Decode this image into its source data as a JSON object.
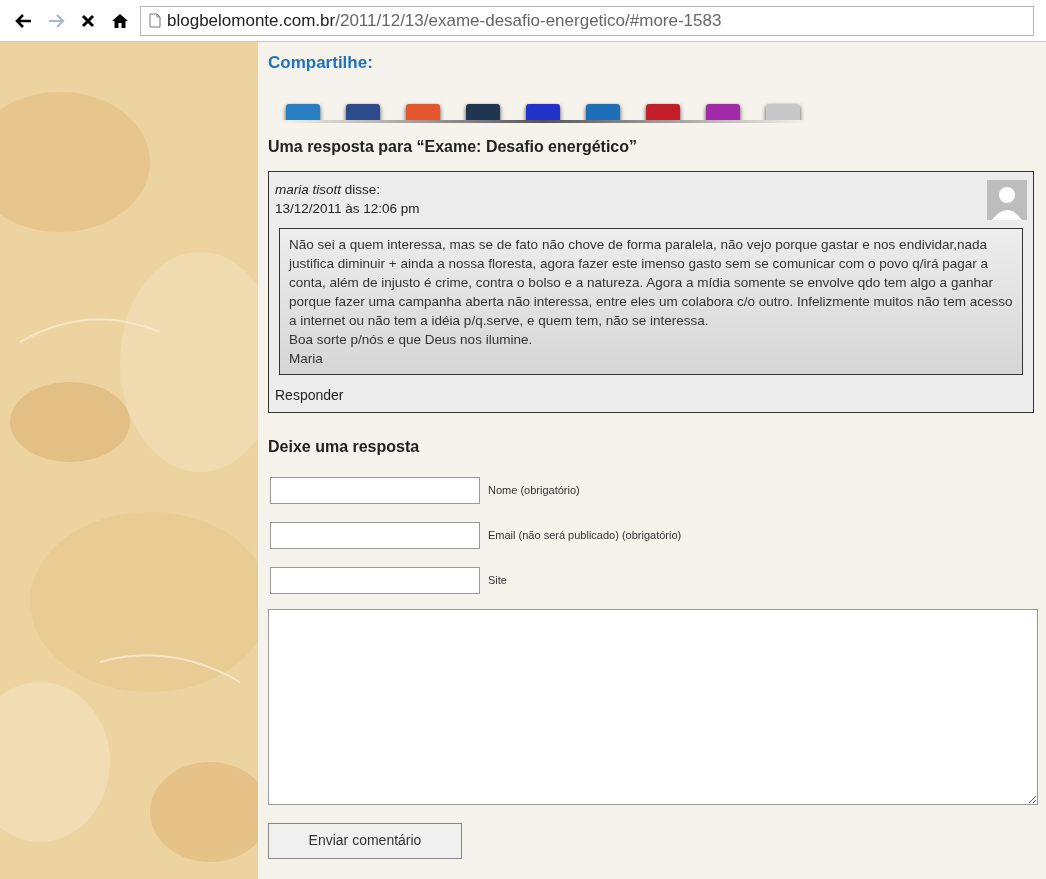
{
  "browser": {
    "back_disabled": false,
    "forward_disabled": true,
    "url_host": "blogbelomonte.com.br",
    "url_path": "/2011/12/13/exame-desafio-energetico/#more-1583"
  },
  "share": {
    "title": "Compartilhe:",
    "icons": [
      {
        "color": "#2a7fc4"
      },
      {
        "color": "#2d4a8a"
      },
      {
        "color": "#e4572e"
      },
      {
        "color": "#1f3550"
      },
      {
        "color": "#2233cc"
      },
      {
        "color": "#1f6fb8"
      },
      {
        "color": "#c41e2a"
      },
      {
        "color": "#a02aa8"
      },
      {
        "color": "#c8c8c8"
      }
    ]
  },
  "comments_title": "Uma resposta para “Exame: Desafio energético”",
  "comment": {
    "author": "*maria tisott* disse:",
    "date": "13/12/2011 às 12:06 pm",
    "paragraphs": [
      "Não sei a quem interessa, mas se de fato não chove de forma paralela, não vejo porque gastar e nos endividar,nada justifica diminuir + ainda a nossa floresta, agora fazer este imenso gasto sem se comunicar com o povo q/irá pagar a conta, além de injusto é crime, contra o bolso e a natureza. Agora a mídia somente se envolve qdo tem algo a ganhar porque fazer uma campanha aberta não interessa, entre eles um colabora c/o outro. Infelizmente muitos não tem acesso a internet ou não tem a idéia p/q.serve, e quem tem, não se interessa.",
      "Boa sorte p/nós e que Deus nos ilumine.",
      "Maria"
    ],
    "reply": "Responder"
  },
  "form": {
    "title": "Deixe uma resposta",
    "fields": [
      {
        "label": "Nome (obrigatório)"
      },
      {
        "label": "Email (não será publicado) (obrigatório)"
      },
      {
        "label": "Site"
      }
    ],
    "submit": "Enviar comentário"
  }
}
